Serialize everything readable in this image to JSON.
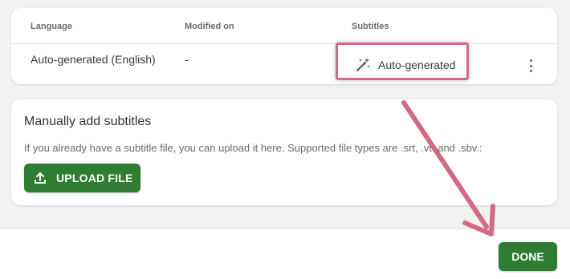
{
  "table": {
    "headers": {
      "language": "Language",
      "modified": "Modified on",
      "subtitles": "Subtitles"
    },
    "row": {
      "language": "Auto-generated (English)",
      "modified": "-",
      "subtitles": "Auto-generated",
      "subtitles_icon": "magic-wand-icon",
      "menu_icon": "more-vert-icon"
    }
  },
  "upload": {
    "title": "Manually add subtitles",
    "description": "If you already have a subtitle file, you can upload it here. Supported file types are .srt, .vtt and .sbv.:",
    "button_label": "UPLOAD FILE",
    "button_icon": "upload-icon"
  },
  "footer": {
    "done_label": "DONE"
  },
  "annotation": {
    "highlight_color": "#d26a84",
    "arrow_color": "#d26a84"
  },
  "colors": {
    "accent": "#2e7d32",
    "background": "#f2f2f2"
  }
}
